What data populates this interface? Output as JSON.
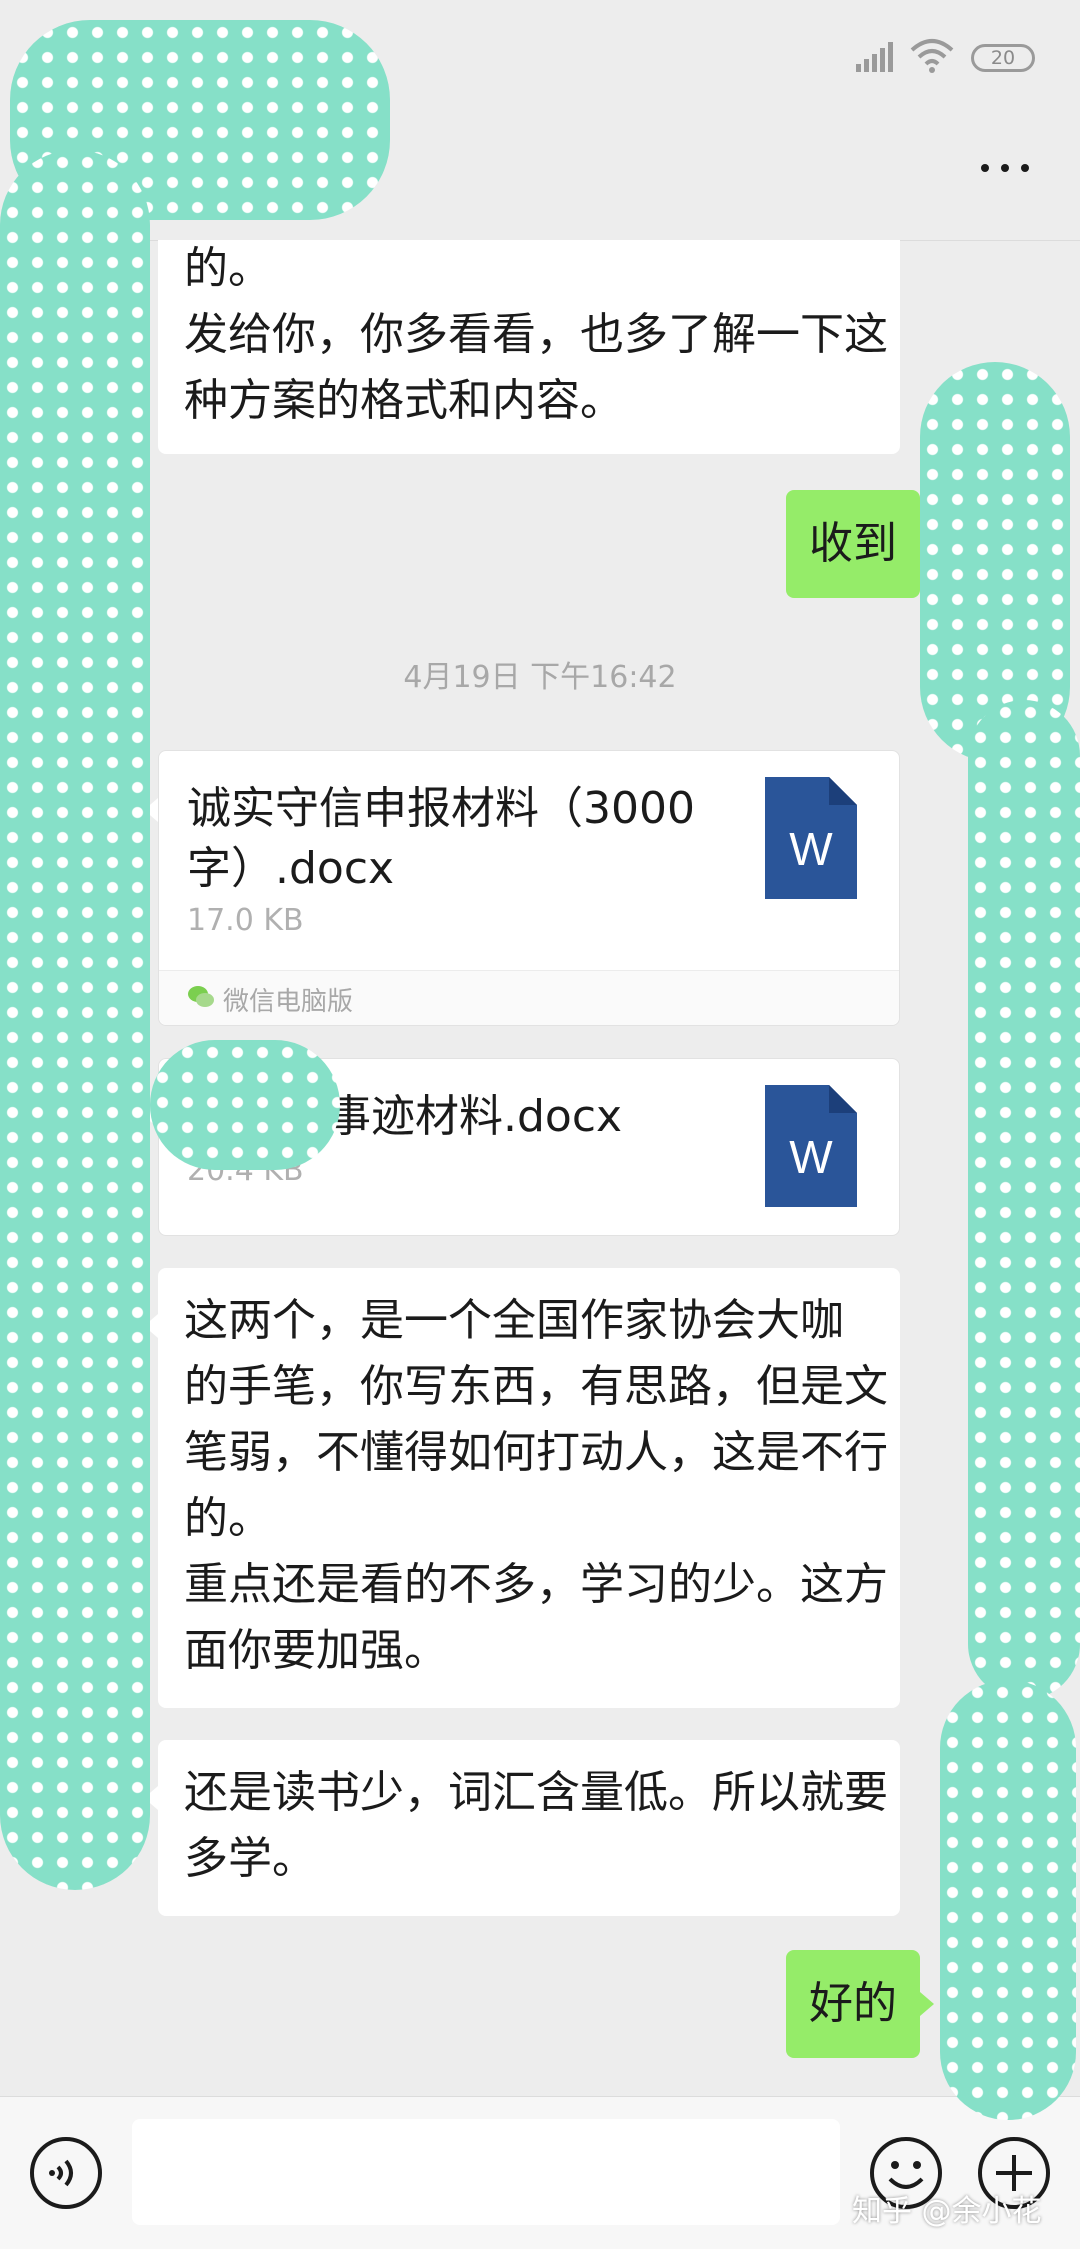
{
  "status_bar": {
    "battery": "20"
  },
  "title_bar": {
    "more_icon": "more-dots-icon"
  },
  "messages": {
    "m1": {
      "lines": [
        "的。",
        "发给你，你多看看，也多了解一下这",
        "种方案的格式和内容。"
      ]
    },
    "m2": {
      "text": "收到"
    },
    "timestamp": "4月19日 下午16:42",
    "file1": {
      "name_line1": "诚实守信申报材料（3000",
      "name_line2": "字）.docx",
      "size": "17.0 KB",
      "source": "微信电脑版",
      "icon": "word-doc-icon"
    },
    "file2": {
      "name": "事迹材料.docx",
      "size": "20.4 KB",
      "icon": "word-doc-icon"
    },
    "m3": {
      "lines": [
        "这两个，是一个全国作家协会大咖",
        "的手笔，你写东西，有思路，但是文",
        "笔弱，不懂得如何打动人，这是不行",
        "的。",
        "重点还是看的不多，学习的少。这方",
        "面你要加强。"
      ]
    },
    "m4": {
      "lines": [
        "还是读书少，词汇含量低。所以就要",
        "多学。"
      ]
    },
    "m5": {
      "text": "好的"
    }
  },
  "input_bar": {
    "placeholder": ""
  },
  "watermark": "知乎 @余小花",
  "colors": {
    "background": "#ededed",
    "outgoing_bubble": "#95ec69",
    "incoming_bubble": "#ffffff",
    "word_icon": "#2a5599",
    "redaction": "#86e0c8"
  }
}
